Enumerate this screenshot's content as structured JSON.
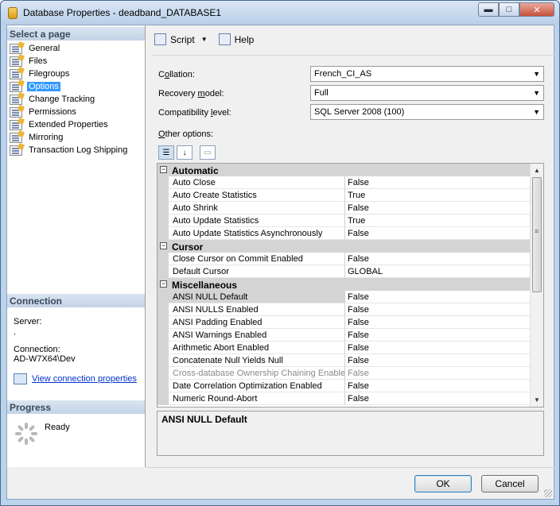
{
  "window": {
    "title": "Database Properties - deadband_DATABASE1",
    "min_glyph": "▬",
    "max_glyph": "□",
    "close_glyph": "✕"
  },
  "left": {
    "select_header": "Select a page",
    "pages": [
      {
        "label": "General"
      },
      {
        "label": "Files"
      },
      {
        "label": "Filegroups"
      },
      {
        "label": "Options",
        "selected": true
      },
      {
        "label": "Change Tracking"
      },
      {
        "label": "Permissions"
      },
      {
        "label": "Extended Properties"
      },
      {
        "label": "Mirroring"
      },
      {
        "label": "Transaction Log Shipping"
      }
    ],
    "connection_header": "Connection",
    "server_label": "Server:",
    "server_value": ".",
    "connection_label": "Connection:",
    "connection_value": "AD-W7X64\\Dev",
    "view_link": "View connection properties",
    "progress_header": "Progress",
    "progress_status": "Ready"
  },
  "toolbar": {
    "script_label": "Script",
    "dropdown_arrow": "▼",
    "help_label": "Help"
  },
  "form": {
    "collation_label_pre": "C",
    "collation_label_ug": "o",
    "collation_label_post": "llation:",
    "collation_value": "French_CI_AS",
    "recovery_label_pre": "Recovery ",
    "recovery_label_ug": "m",
    "recovery_label_post": "odel:",
    "recovery_value": "Full",
    "compat_label_pre": "Compatibility ",
    "compat_label_ug": "l",
    "compat_label_post": "evel:",
    "compat_value": "SQL Server 2008 (100)",
    "other_label_pre": "",
    "other_label_ug": "O",
    "other_label_post": "ther options:",
    "combo_arrow": "▼"
  },
  "grid": {
    "categories": [
      {
        "name": "Automatic",
        "rows": [
          {
            "name": "Auto Close",
            "value": "False"
          },
          {
            "name": "Auto Create Statistics",
            "value": "True"
          },
          {
            "name": "Auto Shrink",
            "value": "False"
          },
          {
            "name": "Auto Update Statistics",
            "value": "True"
          },
          {
            "name": "Auto Update Statistics Asynchronously",
            "value": "False"
          }
        ]
      },
      {
        "name": "Cursor",
        "rows": [
          {
            "name": "Close Cursor on Commit Enabled",
            "value": "False"
          },
          {
            "name": "Default Cursor",
            "value": "GLOBAL"
          }
        ]
      },
      {
        "name": "Miscellaneous",
        "rows": [
          {
            "name": "ANSI NULL Default",
            "value": "False",
            "selected": true
          },
          {
            "name": "ANSI NULLS Enabled",
            "value": "False"
          },
          {
            "name": "ANSI Padding Enabled",
            "value": "False"
          },
          {
            "name": "ANSI Warnings Enabled",
            "value": "False"
          },
          {
            "name": "Arithmetic Abort Enabled",
            "value": "False"
          },
          {
            "name": "Concatenate Null Yields Null",
            "value": "False"
          },
          {
            "name": "Cross-database Ownership Chaining Enabled",
            "value": "False",
            "disabled": true
          },
          {
            "name": "Date Correlation Optimization Enabled",
            "value": "False"
          },
          {
            "name": "Numeric Round-Abort",
            "value": "False"
          }
        ]
      }
    ],
    "collapse_glyph": "−",
    "description": "ANSI NULL Default"
  },
  "buttons": {
    "ok": "OK",
    "cancel": "Cancel"
  }
}
